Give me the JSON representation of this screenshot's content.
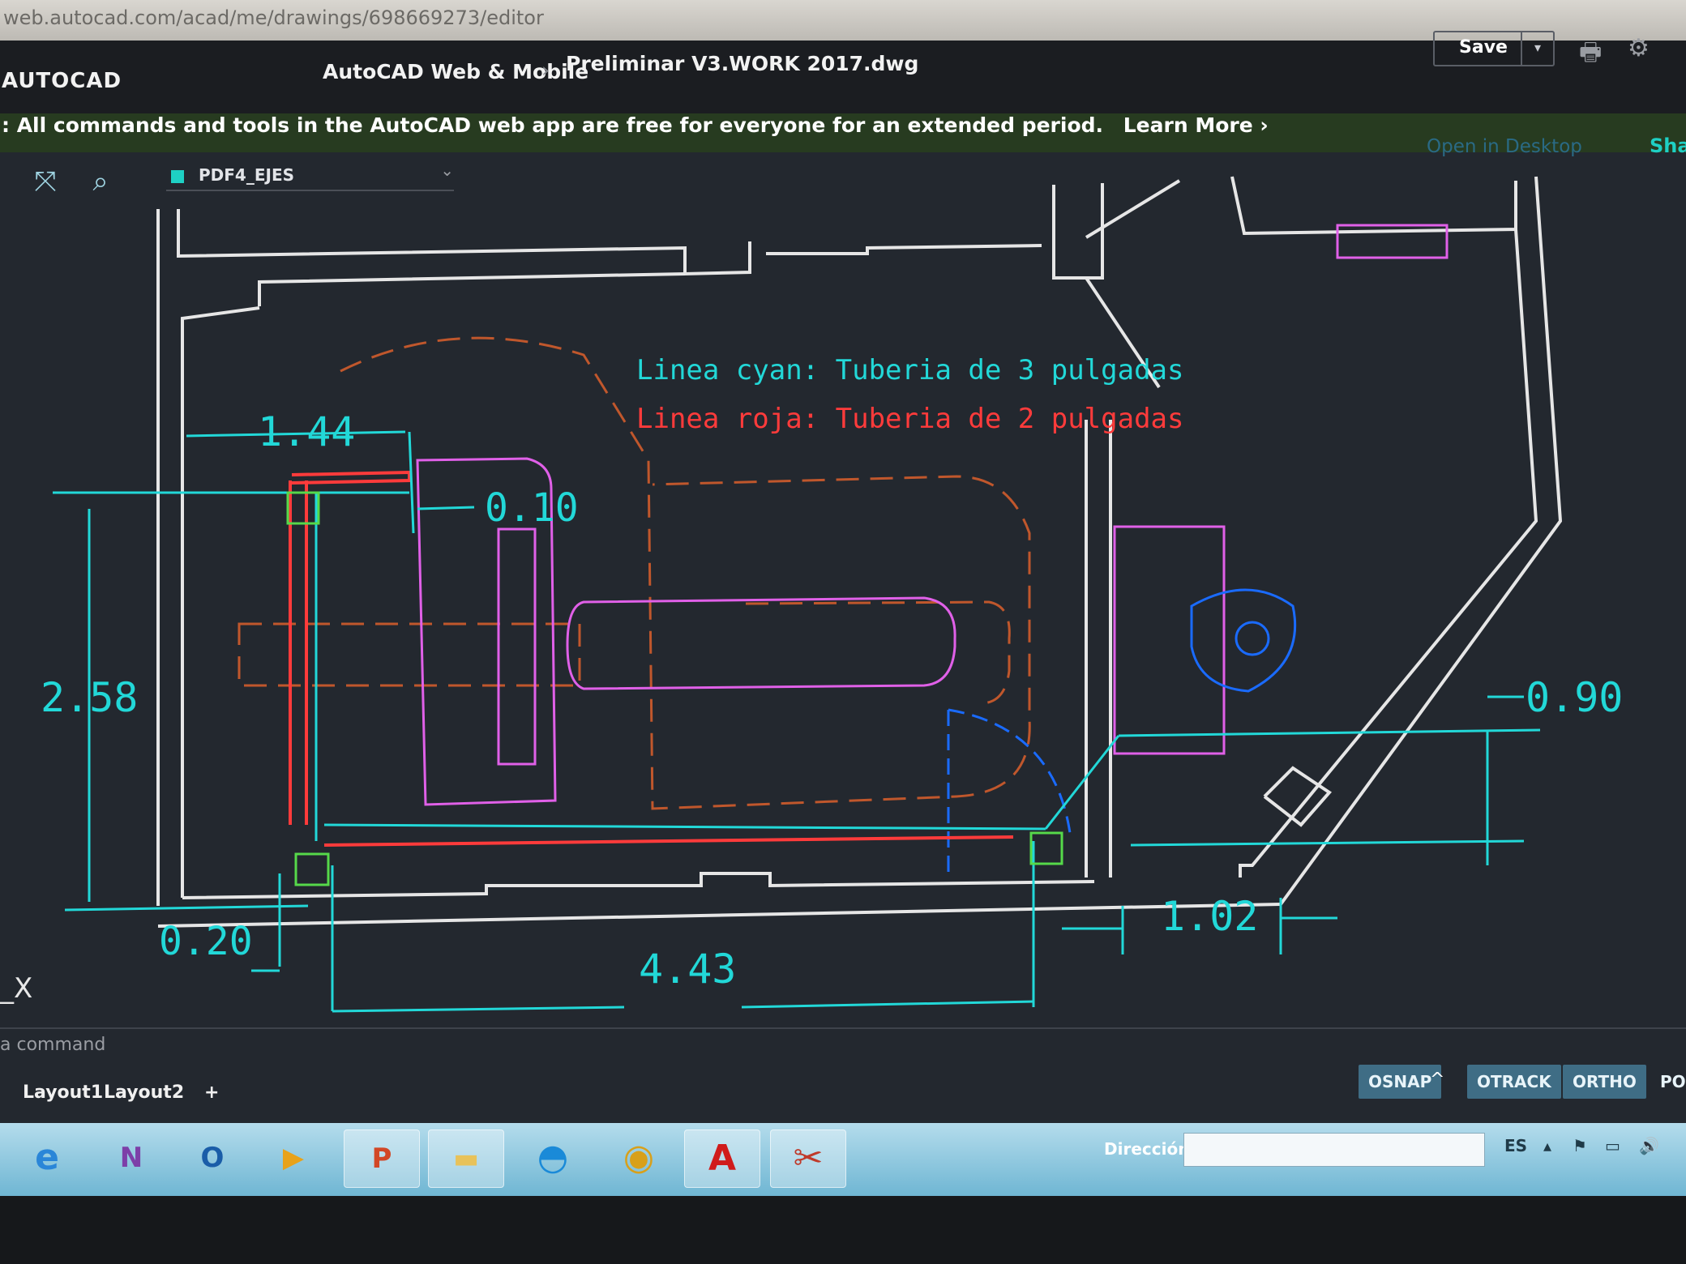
{
  "browser": {
    "url": "web.autocad.com/acad/me/drawings/698669273/editor"
  },
  "app": {
    "brand": "AUTOCAD",
    "breadcrumb": [
      "AutoCAD Web & Mobile",
      "Preliminar V3.WORK 2017.dwg"
    ],
    "breadcrumb_sep": "›",
    "save_label": "Save",
    "save_dropdown": "▾"
  },
  "banner": {
    "text": ": All commands and tools in the AutoCAD web app are free for everyone for an extended period.",
    "link": "Learn More ›"
  },
  "toolbar": {
    "layer_name": "PDF4_EJES",
    "layer_chevron": "⌄",
    "open_desktop": "Open in Desktop",
    "share": "Shar"
  },
  "drawing": {
    "notes": [
      "Linea cyan: Tuberia de 3 pulgadas",
      "Linea roja: Tuberia de 2 pulgadas"
    ],
    "dimensions": {
      "d144": "1.44",
      "d010": "0.10",
      "d258": "2.58",
      "d090": "0.90",
      "d102": "1.02",
      "d020": "0.20",
      "d443": "4.43"
    },
    "ucs_label": "_X",
    "colors": {
      "walls": "#e6e6e6",
      "cyan": "#22d8d8",
      "red": "#ff3b3b",
      "magenta": "#e060e8",
      "orange": "#c0572c",
      "blue": "#1a6bff",
      "green": "#56d94a"
    }
  },
  "command_line": {
    "placeholder": "a command"
  },
  "layouts": {
    "tabs": [
      "Layout1",
      "Layout2"
    ],
    "add": "+"
  },
  "status_toggles": [
    "OSNAP",
    "OTRACK",
    "ORTHO",
    "POL"
  ],
  "osnap_arrow": "^",
  "taskbar": {
    "address_label": "Dirección",
    "lang": "ES",
    "apps": [
      "internet-explorer",
      "onenote",
      "outlook",
      "media-player",
      "powerpoint",
      "file-explorer",
      "edge",
      "chrome",
      "autocad",
      "snipping-tool"
    ]
  }
}
